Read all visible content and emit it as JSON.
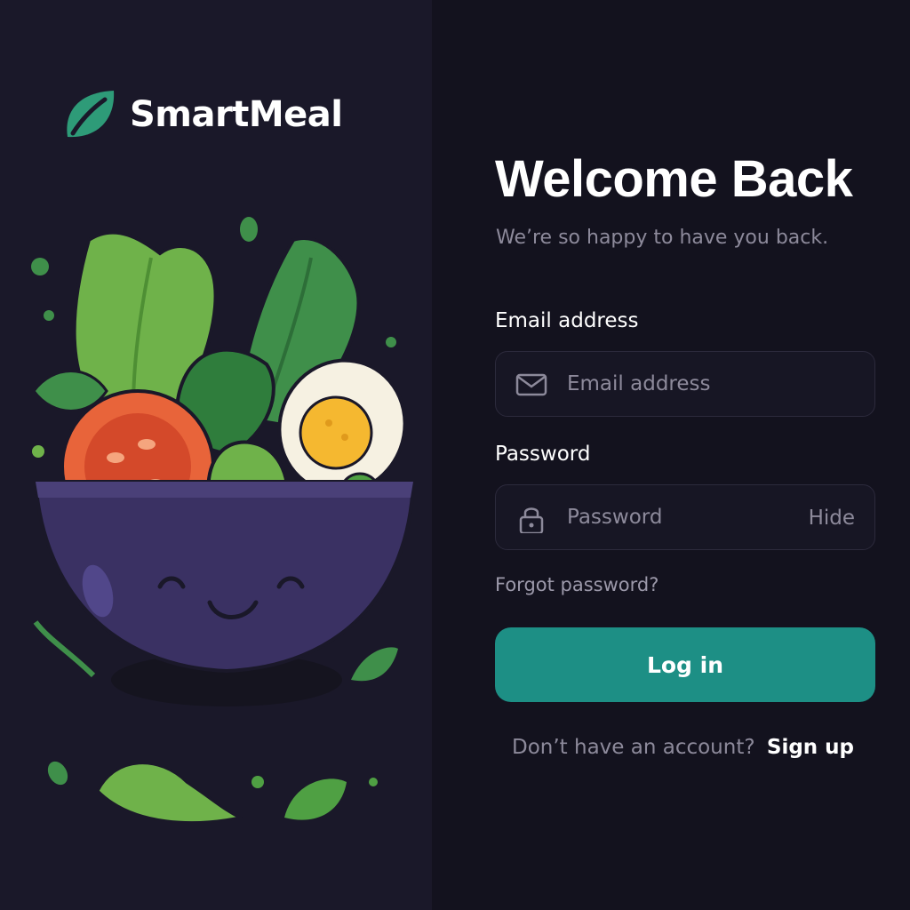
{
  "brand": {
    "name": "SmartMeal"
  },
  "login": {
    "title": "Welcome Back",
    "subtitle": "We’re so happy to have you back.",
    "email": {
      "label": "Email address",
      "placeholder": "Email address",
      "icon": "envelope-icon"
    },
    "password": {
      "label": "Password",
      "placeholder": "Password",
      "toggle_label": "Hide",
      "icon": "lock-icon"
    },
    "forgot_label": "Forgot password?",
    "submit_label": "Log in",
    "signup_prompt": "Don’t have an account?",
    "signup_link": "Sign up"
  },
  "colors": {
    "accent": "#1d8f85",
    "panel_left": "#1a1829",
    "panel_right": "#13121e",
    "muted_text": "#8d8a9b",
    "leaf_green": "#4caf50"
  }
}
